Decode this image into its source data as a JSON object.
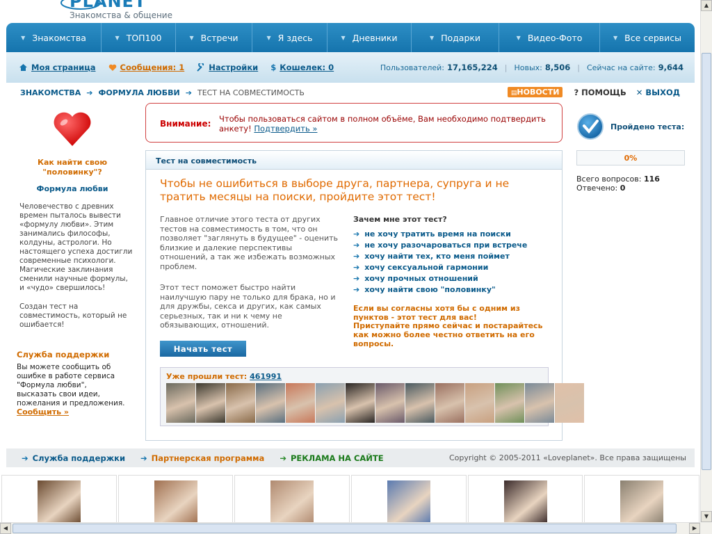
{
  "logo": {
    "word": "PLANET",
    "tagline": "Знакомства & общение"
  },
  "nav": [
    {
      "label": "Знакомства",
      "w": 137
    },
    {
      "label": "ТОП100",
      "w": 107
    },
    {
      "label": "Встречи",
      "w": 110
    },
    {
      "label": "Я здесь",
      "w": 108
    },
    {
      "label": "Дневники",
      "w": 121
    },
    {
      "label": "Подарки",
      "w": 126
    },
    {
      "label": "Видео-Фото",
      "w": 145
    },
    {
      "label": "Все сервисы",
      "w": 136
    }
  ],
  "userbar": {
    "my_page": "Моя страница",
    "messages": "Сообщения: 1",
    "settings": "Настройки",
    "wallet": "Кошелек: 0",
    "wallet_symbol": "$",
    "stats": {
      "users_label": "Пользователей:",
      "users": "17,165,224",
      "new_label": "Новых:",
      "new": "8,506",
      "online_label": "Сейчас на сайте:",
      "online": "9,644"
    }
  },
  "breadcrumb": {
    "first": "ЗНАКОМСТВА",
    "second": "ФОРМУЛА ЛЮБВИ",
    "current": "ТЕСТ НА СОВМЕСТИМОСТЬ",
    "arrow": "➔"
  },
  "topright": {
    "news": "НОВОСТИ",
    "help": "? ПОМОЩЬ",
    "exit": "✕ ВЫХОД"
  },
  "left": {
    "title": "Как найти свою \"половинку\"?",
    "subtitle": "Формула любви",
    "p1": "Человечество с древних времен пыталось вывести «формулу любви». Этим занимались философы, колдуны, астрологи. Но настоящего успеха достигли современные психологи. Магические заклинания сменили научные формулы, и «чудо» свершилось!",
    "p2": "Создан тест на совместимость, который не ошибается!",
    "support_title": "Служба поддержки",
    "support_text": "Вы можете сообщить об ошибке в работе сервиса \"Формула любви\", высказать свои идеи, пожелания и предложения.",
    "support_link": "Сообщить »"
  },
  "warning": {
    "label": "Внимание:",
    "text": "Чтобы пользоваться сайтом в полном объёме, Вам необходимо подтвердить анкету!",
    "link": "Подтвердить »"
  },
  "panel": {
    "header": "Тест на совместимость",
    "headline": "Чтобы не ошибиться в выборе друга, партнера, супруга и не тратить месяцы на поиски, пройдите этот тест!",
    "intro1": "Главное отличие этого теста от других тестов на совместимость в том, что он позволяет \"заглянуть в будущее\" - оценить близкие и далекие перспективы отношений, а так же избежать возможных проблем.",
    "intro2": "Этот тест поможет быстро найти наилучшую пару не только для брака, но и для дружбы, секса и других, как самых серьезных, так и ни к чему не обязывающих, отношений.",
    "why_title": "Зачем мне этот тест?",
    "why": [
      "не хочу тратить время на поиски",
      "не хочу разочароваться при встрече",
      "хочу найти тех, кто меня поймет",
      "хочу сексуальной гармонии",
      "хочу прочных отношений",
      "хочу найти свою \"половинку\""
    ],
    "agree1": "Если вы согласны хотя бы с одним из пунктов - этот тест для вас!",
    "agree2": "Приступайте прямо сейчас и постарайтесь как можно более честно ответить на его вопросы.",
    "start": "Начать тест",
    "passed_label": "Уже прошли тест:",
    "passed_count": "461991"
  },
  "thumbs": [
    "#6b6a5e",
    "#3d3a30",
    "#8a6b4a",
    "#5a7080",
    "#c8785a",
    "#8aa0b0",
    "#2a2624",
    "#6a5a6a",
    "#4a5a60",
    "#9a7060",
    "#c8a080",
    "#70905a",
    "#7a8a98",
    "#e0c0a8"
  ],
  "right": {
    "passed_test": "Пройдено теста:",
    "progress": "0%",
    "progress_value": 0,
    "total_label": "Всего вопросов:",
    "total": "116",
    "answered_label": "Отвечено:",
    "answered": "0"
  },
  "footer": {
    "support": "Служба поддержки",
    "partner": "Партнерская программа",
    "ads": "РЕКЛАМА НА САЙТЕ",
    "copyright": "Copyright © 2005-2011 «Loveplanet». Все права защищены"
  },
  "ad_colors": [
    "#6a4a30",
    "#a07050",
    "#b08a70",
    "#5a7ab0",
    "#3a2a2a",
    "#8a8070"
  ],
  "colors": {
    "nav": "#1a7cb8",
    "accent": "#e06a00",
    "link": "#0a5a8a"
  }
}
